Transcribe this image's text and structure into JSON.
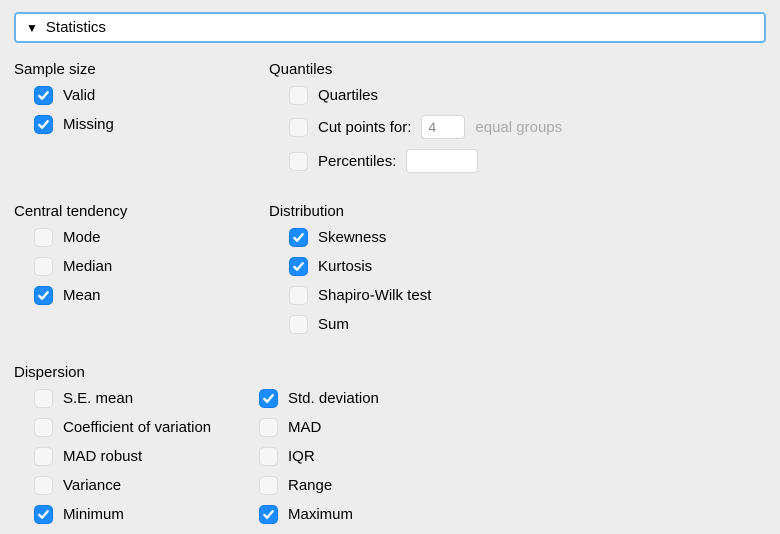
{
  "panel": {
    "title": "Statistics"
  },
  "sections": {
    "sample_size": {
      "title": "Sample size",
      "valid": "Valid",
      "missing": "Missing"
    },
    "quantiles": {
      "title": "Quantiles",
      "quartiles": "Quartiles",
      "cut_points_label": "Cut points for:",
      "cut_points_value": "4",
      "cut_points_suffix": "equal groups",
      "percentiles": "Percentiles:",
      "percentiles_value": ""
    },
    "central_tendency": {
      "title": "Central tendency",
      "mode": "Mode",
      "median": "Median",
      "mean": "Mean"
    },
    "distribution": {
      "title": "Distribution",
      "skewness": "Skewness",
      "kurtosis": "Kurtosis",
      "shapiro": "Shapiro-Wilk test",
      "sum": "Sum"
    },
    "dispersion": {
      "title": "Dispersion",
      "se_mean": "S.E. mean",
      "cov": "Coefficient of variation",
      "mad_robust": "MAD robust",
      "variance": "Variance",
      "minimum": "Minimum",
      "std_dev": "Std. deviation",
      "mad": "MAD",
      "iqr": "IQR",
      "range": "Range",
      "maximum": "Maximum"
    }
  }
}
